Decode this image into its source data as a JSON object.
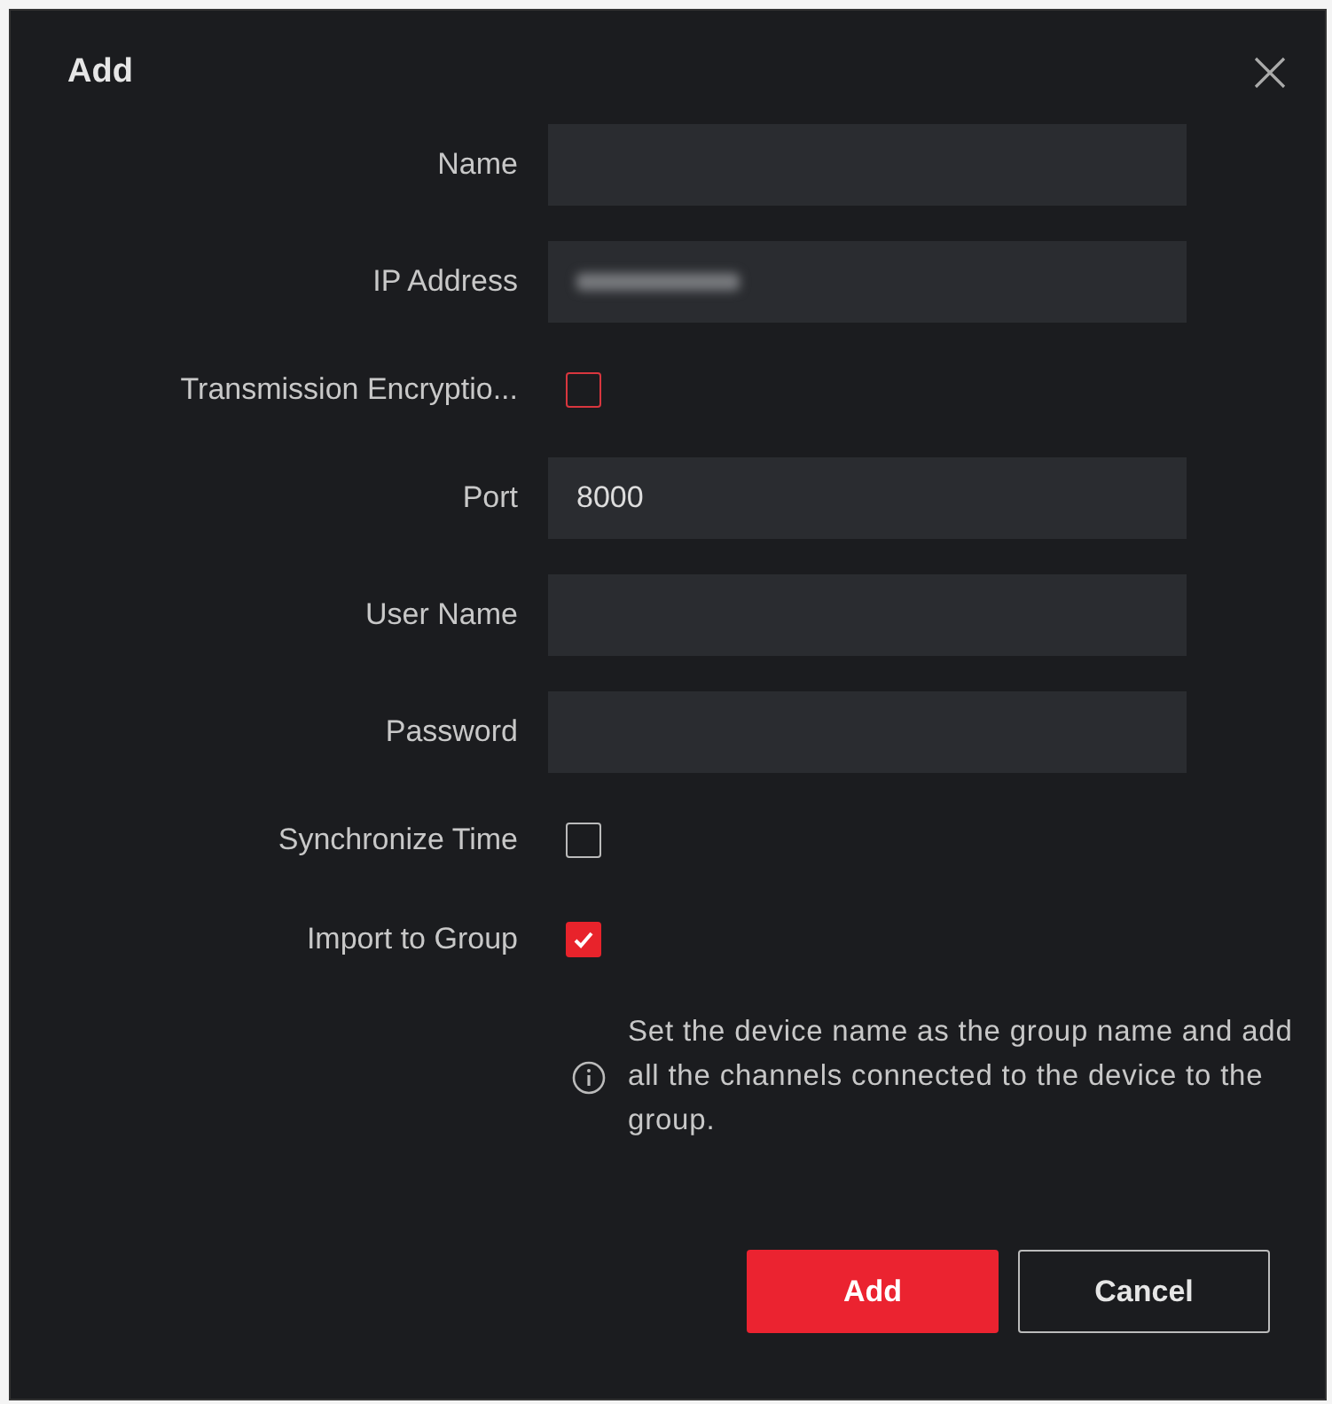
{
  "dialog": {
    "title": "Add"
  },
  "fields": [
    {
      "kind": "text",
      "label": "Name"
    },
    {
      "kind": "text",
      "label": "IP Address",
      "value_redacted": true
    },
    {
      "kind": "checkbox",
      "label": "Transmission Encryptio...",
      "checked": false,
      "color": "#d9363e"
    },
    {
      "kind": "text",
      "label": "Port",
      "value": "8000"
    },
    {
      "kind": "text",
      "label": "User Name"
    },
    {
      "kind": "text",
      "label": "Password"
    },
    {
      "kind": "checkbox",
      "label": "Synchronize Time",
      "checked": false,
      "color": "#bbbbbb"
    },
    {
      "kind": "checkbox",
      "label": "Import to Group",
      "checked": true,
      "color": "#e8232b"
    }
  ],
  "hint": "Set the device name as the group name and add all the channels connected to the device to the group.",
  "buttons": [
    {
      "kind": "primary",
      "label": "Add"
    },
    {
      "kind": "secondary",
      "label": "Cancel"
    }
  ]
}
